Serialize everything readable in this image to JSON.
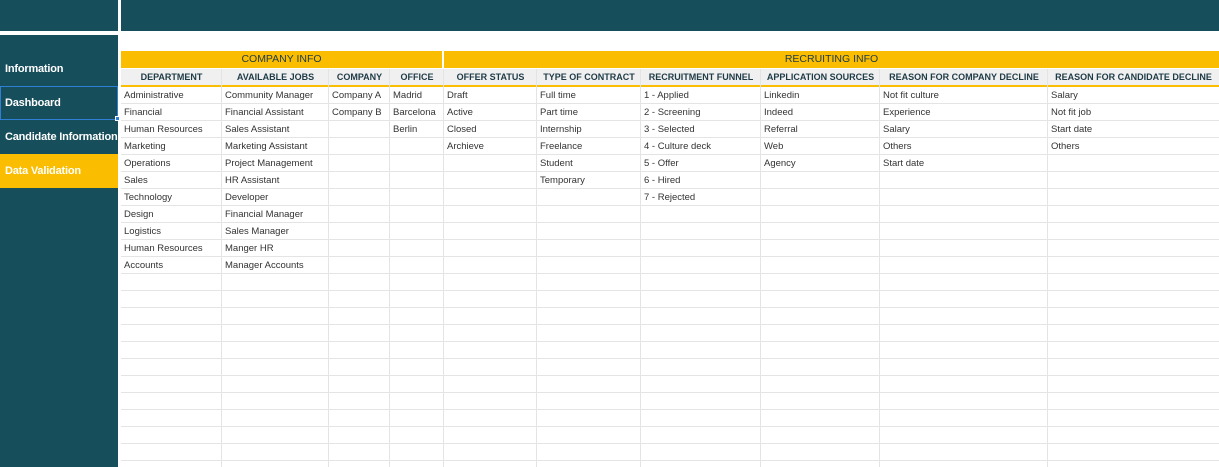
{
  "sidebar": {
    "items": [
      {
        "label": "Information"
      },
      {
        "label": "Dashboard"
      },
      {
        "label": "Candidate Information"
      },
      {
        "label": "Data Validation"
      }
    ],
    "active_color": "#fbbd00",
    "bg_color": "#174e5c"
  },
  "groups": {
    "company_info": "COMPANY INFO",
    "recruiting_info": "RECRUITING INFO"
  },
  "columns": [
    {
      "header": "DEPARTMENT",
      "values": [
        "Administrative",
        "Financial",
        "Human Resources",
        "Marketing",
        "Operations",
        "Sales",
        "Technology",
        "Design",
        "Logistics",
        "Human Resources",
        "Accounts"
      ]
    },
    {
      "header": "AVAILABLE JOBS",
      "values": [
        "Community Manager",
        "Financial Assistant",
        "Sales Assistant",
        "Marketing Assistant",
        "Project Management",
        "HR Assistant",
        "Developer",
        "Financial Manager",
        "Sales Manager",
        "Manger HR",
        "Manager Accounts"
      ]
    },
    {
      "header": "COMPANY",
      "values": [
        "Company A",
        "Company B"
      ]
    },
    {
      "header": "OFFICE",
      "values": [
        "Madrid",
        "Barcelona",
        "Berlin"
      ]
    },
    {
      "header": "OFFER STATUS",
      "values": [
        "Draft",
        "Active",
        "Closed",
        "Archieve"
      ]
    },
    {
      "header": "TYPE OF CONTRACT",
      "values": [
        "Full time",
        "Part time",
        "Internship",
        "Freelance",
        "Student",
        "Temporary"
      ]
    },
    {
      "header": "RECRUITMENT FUNNEL",
      "values": [
        "1 - Applied",
        "2 - Screening",
        "3 - Selected",
        "4 - Culture deck",
        "5 - Offer",
        "6 - Hired",
        "7 - Rejected"
      ]
    },
    {
      "header": "APPLICATION SOURCES",
      "values": [
        "Linkedin",
        "Indeed",
        "Referral",
        "Web",
        "Agency"
      ]
    },
    {
      "header": "REASON FOR COMPANY DECLINE",
      "values": [
        "Not fit culture",
        "Experience",
        "Salary",
        "Others",
        "Start date"
      ]
    },
    {
      "header": "REASON FOR CANDIDATE DECLINE",
      "values": [
        "Salary",
        "Not fit job",
        "Start date",
        "Others"
      ]
    }
  ]
}
